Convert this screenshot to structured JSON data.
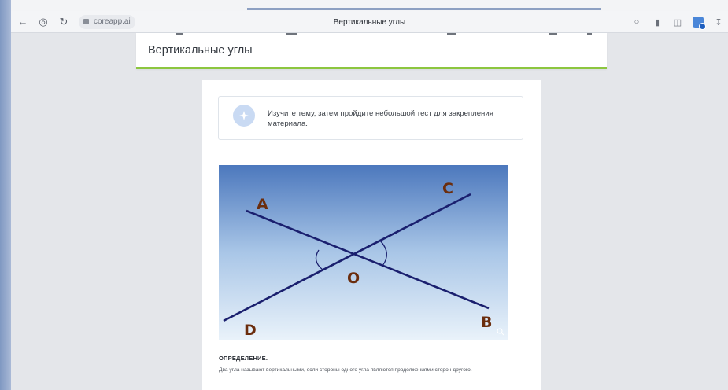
{
  "browser": {
    "url": "coreapp.ai",
    "tab_title": "Вертикальные углы"
  },
  "lesson": {
    "title": "Вертикальные углы",
    "intro_text": "Изучите тему, затем пройдите небольшой тест для закрепления материала.",
    "diagram": {
      "labels": {
        "a": "A",
        "b": "B",
        "c": "C",
        "d": "D",
        "o": "O"
      },
      "colors": {
        "line": "#1a1f6e",
        "label": "#6b2d0d",
        "sky_top": "#4c78bd",
        "sky_bottom": "#e9f2fa"
      }
    },
    "definition_title": "ОПРЕДЕЛЕНИЕ.",
    "definition_text": "Два угла называют вертикальными, если стороны одного угла являются продолжениями сторон другого."
  },
  "theme": {
    "accent_green": "#8cc63f",
    "info_icon_bg": "#c9daf3"
  },
  "icons": [
    "back-arrow-icon",
    "history-icon",
    "reload-icon",
    "lock-icon",
    "chat-icon",
    "bookmark-icon",
    "extensions-icon",
    "profile-extension-icon",
    "sparkle-icon",
    "zoom-icon"
  ]
}
